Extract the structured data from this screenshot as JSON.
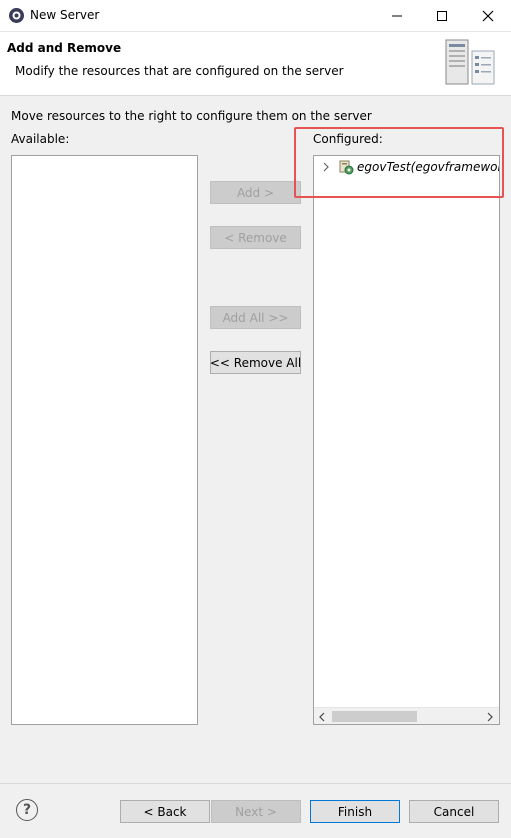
{
  "window": {
    "title": "New Server",
    "icon": "eclipse-server-icon",
    "minimize_icon": "minimize-icon",
    "maximize_icon": "maximize-icon",
    "close_icon": "close-icon"
  },
  "banner": {
    "title": "Add and Remove",
    "description": "Modify the resources that are configured on the server",
    "icon": "server-wizard-icon"
  },
  "instructions": "Move resources to the right to configure them on the server",
  "available": {
    "label": "Available:",
    "items": []
  },
  "configured": {
    "label": "Configured:",
    "items": [
      {
        "label": "egovTest(egovframework-",
        "icon": "web-project-icon",
        "expander": "chevron-right-icon"
      }
    ]
  },
  "buttons": {
    "add": "Add >",
    "remove": "< Remove",
    "add_all": "Add All >>",
    "remove_all": "<< Remove All"
  },
  "footer": {
    "help": "?",
    "back": "< Back",
    "next": "Next >",
    "finish": "Finish",
    "cancel": "Cancel"
  },
  "colors": {
    "highlight": "#e55353",
    "default_button_border": "#0078d7"
  }
}
